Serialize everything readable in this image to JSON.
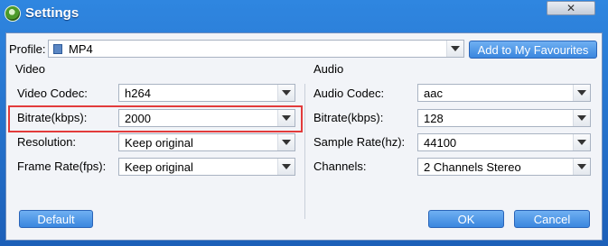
{
  "window": {
    "title": "Settings",
    "close_symbol": "✕"
  },
  "profile": {
    "label": "Profile:",
    "value": "MP4",
    "favourites_button": "Add to My Favourites"
  },
  "video": {
    "heading": "Video",
    "fields": [
      {
        "label": "Video Codec:",
        "value": "h264"
      },
      {
        "label": "Bitrate(kbps):",
        "value": "2000"
      },
      {
        "label": "Resolution:",
        "value": "Keep original"
      },
      {
        "label": "Frame Rate(fps):",
        "value": "Keep original"
      }
    ]
  },
  "audio": {
    "heading": "Audio",
    "fields": [
      {
        "label": "Audio Codec:",
        "value": "aac"
      },
      {
        "label": "Bitrate(kbps):",
        "value": "128"
      },
      {
        "label": "Sample Rate(hz):",
        "value": "44100"
      },
      {
        "label": "Channels:",
        "value": "2 Channels Stereo"
      }
    ]
  },
  "buttons": {
    "default": "Default",
    "ok": "OK",
    "cancel": "Cancel"
  },
  "colors": {
    "title_bar": "#2f86e0",
    "button": "#3a86de",
    "highlight": "#e23b3b"
  }
}
